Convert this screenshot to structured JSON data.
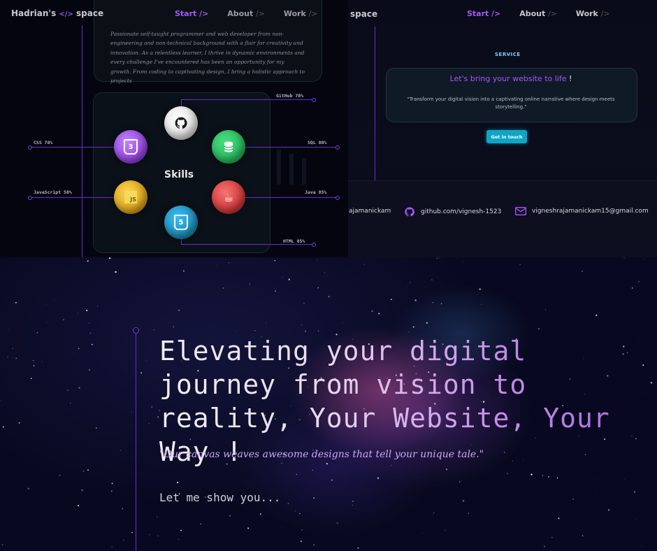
{
  "left_panel": {
    "logo": {
      "text_before": "Hadrian's",
      "icon": "code-icon",
      "text_after": "space"
    },
    "nav": [
      {
        "label": "Start",
        "slash": "/>",
        "active": true
      },
      {
        "label": "About",
        "slash": "/>",
        "active": false
      },
      {
        "label": "Work",
        "slash": "/>",
        "active": false
      }
    ],
    "about_text": "Passionate self-taught programmer and web developer from non-engineering and non-technical background with a flair for creativity and innovation. As a relentless learner, I thrive in dynamic environments and every challenge I've encountered has been an opportunity for my growth. From coding to captivating design, I bring a holistic approach to projects",
    "skills": {
      "title": "Skills",
      "items": [
        {
          "name": "GitHub",
          "label": "GitHub 70%",
          "percent": 70,
          "icon": "github-icon",
          "color": "#eeeeee"
        },
        {
          "name": "SQL",
          "label": "SQL 80%",
          "percent": 80,
          "icon": "database-icon",
          "color": "#22c55e"
        },
        {
          "name": "Java",
          "label": "Java 85%",
          "percent": 85,
          "icon": "java-icon",
          "color": "#dc2626"
        },
        {
          "name": "HTML",
          "label": "HTML 85%",
          "percent": 85,
          "icon": "html5-icon",
          "color": "#0ea5c6"
        },
        {
          "name": "JavaScript",
          "label": "JavaScript 50%",
          "percent": 50,
          "icon": "js-icon",
          "color": "#eab308"
        },
        {
          "name": "CSS",
          "label": "CSS 70%",
          "percent": 70,
          "icon": "css3-icon",
          "color": "#9333ea"
        }
      ],
      "js_badge": "JS",
      "html_badge": "5",
      "css_badge": "3"
    }
  },
  "right_panel": {
    "logo_partial": "space",
    "nav": [
      {
        "label": "Start",
        "slash": "/>",
        "active": true
      },
      {
        "label": "About",
        "slash": "/>",
        "active": false
      },
      {
        "label": "Work",
        "slash": "/>",
        "active": false
      }
    ],
    "service": {
      "heading": "SERVICE",
      "title": "Let's bring your website to life",
      "title_mark": "!",
      "text": "\"Transform your digital vision into a captivating online narrative where design meets storytelling.\"",
      "button": "Get in touch"
    },
    "footer": {
      "linkedin_partial": "ajamanickam",
      "github": {
        "icon": "github-icon",
        "text": "github.com/vignesh-1523"
      },
      "email": {
        "icon": "mail-icon",
        "text": "vigneshrajamanickam15@gmail.com"
      }
    }
  },
  "hero": {
    "headline": "Elevating your digital journey from vision to reality, Your Website, Your Way !",
    "quote": "\"Our canvas weaves awesome designs that tell your unique tale.\"",
    "cta": "Let me show you..."
  },
  "colors": {
    "accent": "#a855f7",
    "line": "#6a2bd8",
    "button": "#0ea5c6",
    "title": "#a855f7"
  }
}
